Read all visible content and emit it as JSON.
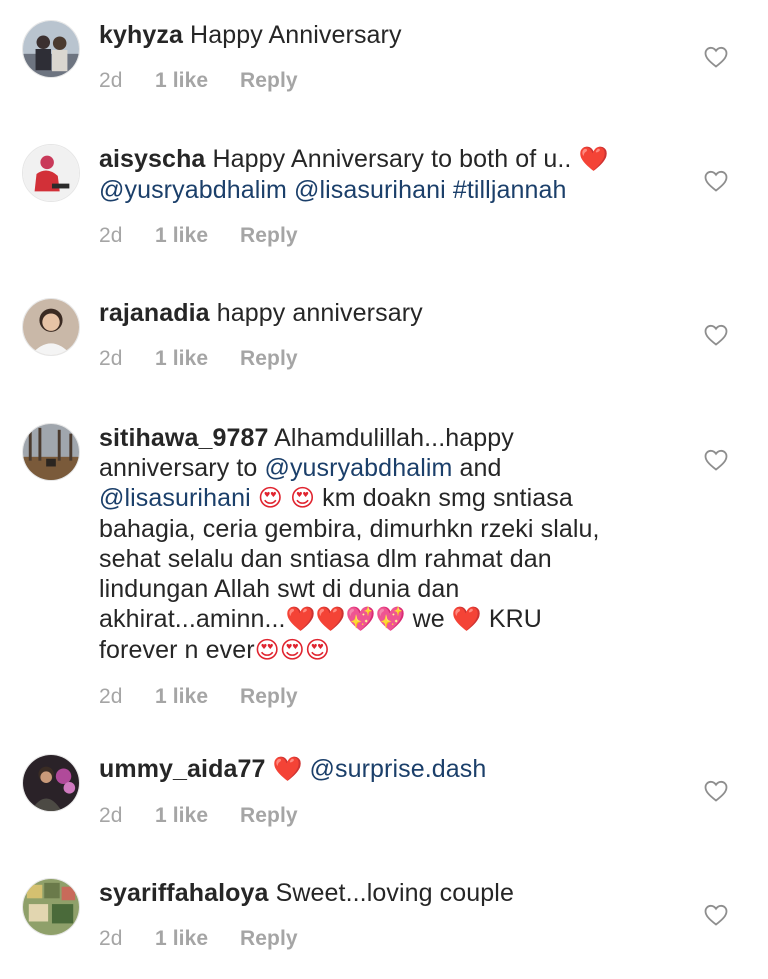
{
  "comments": [
    {
      "username": "kyhyza",
      "segments": [
        {
          "type": "text",
          "value": "Happy Anniversary"
        }
      ],
      "time": "2d",
      "likes": "1 like",
      "reply": "Reply",
      "avatar_icon": "profile-photo-couple"
    },
    {
      "username": "aisyscha",
      "segments": [
        {
          "type": "text",
          "value": "Happy Anniversary to both of u.. "
        },
        {
          "type": "emoji",
          "value": "❤️"
        },
        {
          "type": "break"
        },
        {
          "type": "mention",
          "value": "@yusryabdhalim"
        },
        {
          "type": "text",
          "value": " "
        },
        {
          "type": "mention",
          "value": "@lisasurihani"
        },
        {
          "type": "text",
          "value": " "
        },
        {
          "type": "hashtag",
          "value": "#tilljannah"
        }
      ],
      "time": "2d",
      "likes": "1 like",
      "reply": "Reply",
      "avatar_icon": "profile-photo-woman-hijab"
    },
    {
      "username": "rajanadia",
      "segments": [
        {
          "type": "text",
          "value": "happy anniversary"
        }
      ],
      "time": "2d",
      "likes": "1 like",
      "reply": "Reply",
      "avatar_icon": "profile-photo-woman"
    },
    {
      "username": "sitihawa_9787",
      "segments": [
        {
          "type": "text",
          "value": "Alhamdulillah...happy"
        },
        {
          "type": "break"
        },
        {
          "type": "text",
          "value": "anniversary to "
        },
        {
          "type": "mention",
          "value": "@yusryabdhalim"
        },
        {
          "type": "text",
          "value": " and"
        },
        {
          "type": "break"
        },
        {
          "type": "mention",
          "value": "@lisasurihani"
        },
        {
          "type": "text",
          "value": " "
        },
        {
          "type": "emoji",
          "value": "😍"
        },
        {
          "type": "text",
          "value": " "
        },
        {
          "type": "emoji",
          "value": "😍"
        },
        {
          "type": "text",
          "value": " km doakn smg sntiasa"
        },
        {
          "type": "break"
        },
        {
          "type": "text",
          "value": "bahagia, ceria gembira, dimurhkn rzeki slalu,"
        },
        {
          "type": "break"
        },
        {
          "type": "text",
          "value": "sehat selalu dan sntiasa dlm rahmat dan"
        },
        {
          "type": "break"
        },
        {
          "type": "text",
          "value": "lindungan Allah swt di dunia dan"
        },
        {
          "type": "break"
        },
        {
          "type": "text",
          "value": "akhirat...aminn..."
        },
        {
          "type": "emoji",
          "value": "❤️"
        },
        {
          "type": "emoji",
          "value": "❤️"
        },
        {
          "type": "emoji",
          "value": "💖"
        },
        {
          "type": "emoji",
          "value": "💖"
        },
        {
          "type": "text",
          "value": " we "
        },
        {
          "type": "emoji",
          "value": "❤️"
        },
        {
          "type": "text",
          "value": " KRU"
        },
        {
          "type": "break"
        },
        {
          "type": "text",
          "value": "forever n ever"
        },
        {
          "type": "emoji",
          "value": "😍"
        },
        {
          "type": "emoji",
          "value": "😍"
        },
        {
          "type": "emoji",
          "value": "😍"
        }
      ],
      "time": "2d",
      "likes": "1 like",
      "reply": "Reply",
      "avatar_icon": "profile-photo-landscape"
    },
    {
      "username": "ummy_aida77",
      "segments": [
        {
          "type": "emoji",
          "value": "❤️"
        },
        {
          "type": "text",
          "value": " "
        },
        {
          "type": "mention",
          "value": "@surprise.dash"
        }
      ],
      "time": "2d",
      "likes": "1 like",
      "reply": "Reply",
      "avatar_icon": "profile-photo-woman-flowers"
    },
    {
      "username": "syariffahaloya",
      "segments": [
        {
          "type": "text",
          "value": "Sweet...loving couple"
        }
      ],
      "time": "2d",
      "likes": "1 like",
      "reply": "Reply",
      "avatar_icon": "profile-photo-collage"
    }
  ]
}
